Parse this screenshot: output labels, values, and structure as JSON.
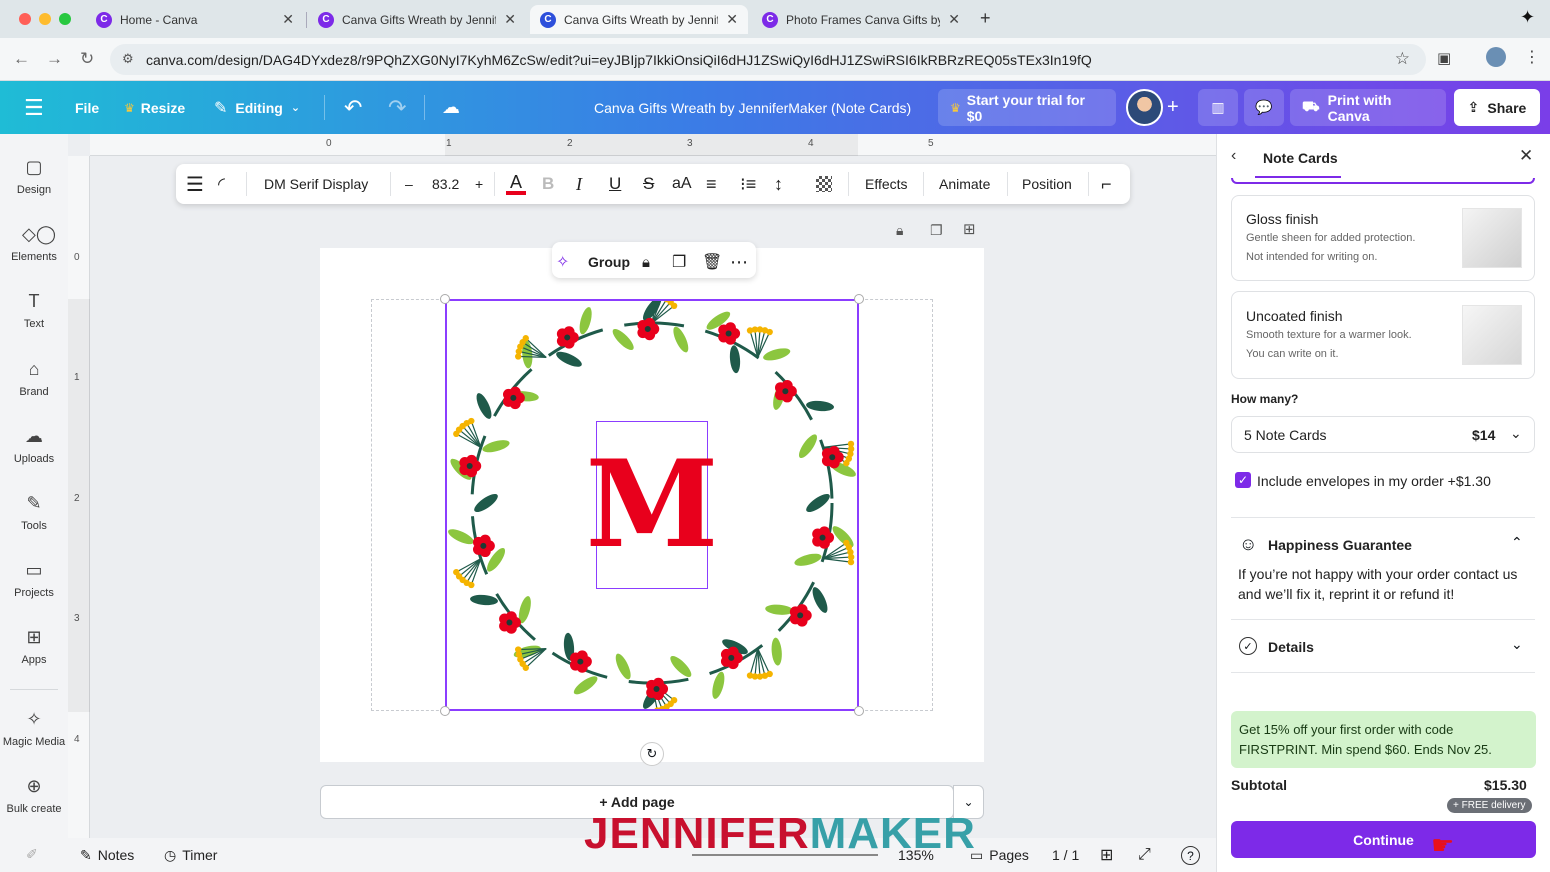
{
  "browser": {
    "tabs": [
      {
        "title": "Home - Canva"
      },
      {
        "title": "Canva Gifts Wreath by Jennif"
      },
      {
        "title": "Canva Gifts Wreath by Jennif"
      },
      {
        "title": "Photo Frames Canva Gifts by"
      }
    ],
    "url": "canva.com/design/DAG4DYxdez8/r9PQhZXG0NyI7KyhM6ZcSw/edit?ui=eyJBIjp7IkkiOnsiQiI6dHJ1ZSwiQyI6dHJ1ZSwiRSI6IkRBRzREQ05sTEx3In19fQ"
  },
  "header": {
    "file": "File",
    "resize": "Resize",
    "editing": "Editing",
    "title": "Canva Gifts Wreath by JenniferMaker (Note Cards)",
    "trial": "Start your trial for $0",
    "print": "Print with Canva",
    "share": "Share"
  },
  "sidebar": {
    "items": [
      {
        "label": "Design",
        "icon": "design-icon"
      },
      {
        "label": "Elements",
        "icon": "elements-icon"
      },
      {
        "label": "Text",
        "icon": "text-icon"
      },
      {
        "label": "Brand",
        "icon": "brand-icon"
      },
      {
        "label": "Uploads",
        "icon": "uploads-icon"
      },
      {
        "label": "Tools",
        "icon": "tools-icon"
      },
      {
        "label": "Projects",
        "icon": "projects-icon"
      },
      {
        "label": "Apps",
        "icon": "apps-icon"
      },
      {
        "label": "Magic Media",
        "icon": "magic-media-icon"
      },
      {
        "label": "Bulk create",
        "icon": "bulk-create-icon"
      }
    ]
  },
  "ruler": {
    "top": [
      "0",
      "1",
      "2",
      "3",
      "4",
      "5"
    ],
    "left": [
      "0",
      "1",
      "2",
      "3",
      "4"
    ]
  },
  "toolbar": {
    "font": "DM Serif Display",
    "size_minus": "–",
    "size": "83.2",
    "size_plus": "+",
    "bold": "B",
    "italic": "I",
    "underline": "U",
    "strike": "S",
    "case": "aA",
    "effects": "Effects",
    "animate": "Animate",
    "position": "Position"
  },
  "canvas": {
    "group": "Group",
    "monogram": "M",
    "add_page": "+ Add page",
    "colors": {
      "accent": "#e8001c",
      "selection": "#8b3dff",
      "leaf_dark": "#1f5a4a",
      "leaf_light": "#8cc63f",
      "berry": "#f5b400"
    }
  },
  "bottom": {
    "notes": "Notes",
    "timer": "Timer",
    "zoom": "135%",
    "pages": "Pages",
    "page_count": "1 / 1"
  },
  "watermark": {
    "part1": "JENNIFER",
    "part2": "MAKER"
  },
  "panel": {
    "title": "Note Cards",
    "gloss_title": "Gloss finish",
    "gloss_desc1": "Gentle sheen for added protection.",
    "gloss_desc2": "Not intended for writing on.",
    "uncoated_title": "Uncoated finish",
    "uncoated_desc1": "Smooth texture for a warmer look.",
    "uncoated_desc2": "You can write on it.",
    "how_many": "How many?",
    "quantity": "5 Note Cards",
    "price": "$14",
    "envelopes": "Include envelopes in my order +$1.30",
    "envelopes_checked": true,
    "guarantee_title": "Happiness Guarantee",
    "guarantee_text": "If you’re not happy with your order contact us and we’ll fix it, reprint it or refund it!",
    "details": "Details",
    "promo": "Get 15% off your first order with code FIRSTPRINT. Min spend $60. Ends Nov 25.",
    "subtotal_label": "Subtotal",
    "subtotal": "$15.30",
    "free_delivery": "+ FREE delivery",
    "continue": "Continue"
  }
}
